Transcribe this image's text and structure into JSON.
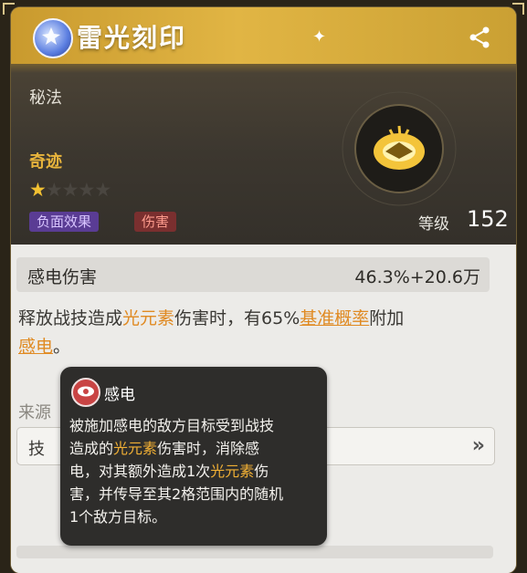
{
  "header": {
    "title": "雷光刻印",
    "category": "秘法",
    "rarity": "奇迹",
    "stars_filled": 1,
    "stars_total": 5,
    "tags": [
      {
        "label": "负面效果",
        "color": "#5a3c94"
      },
      {
        "label": "伤害",
        "color": "#7a2f2f"
      }
    ],
    "level_label": "等级",
    "level_value": "152"
  },
  "stat": {
    "name": "感电伤害",
    "value": "46.3%+20.6万"
  },
  "description": {
    "p1": "释放战技造成",
    "kw1": "光元素",
    "p2": "伤害时，有65%",
    "link": "基准概率",
    "p3": "附加",
    "kw2": "感电",
    "p4": "。"
  },
  "source": {
    "label": "来源",
    "item_text": "技"
  },
  "tooltip": {
    "title": "感电",
    "l1": "被施加感电的敌方目标受到战技",
    "l2a": "造成的",
    "l2kw": "光元素",
    "l2b": "伤害时，消除感",
    "l3a": "电，对其额外造成1次",
    "l3kw": "光元素",
    "l3b": "伤",
    "l4": "害，并传导至其2格范围内的随机",
    "l5": "1个敌方目标。"
  },
  "colors": {
    "gold": "#e8b43c",
    "accent_orange": "#e08a22",
    "dark_bg": "#34302a"
  }
}
